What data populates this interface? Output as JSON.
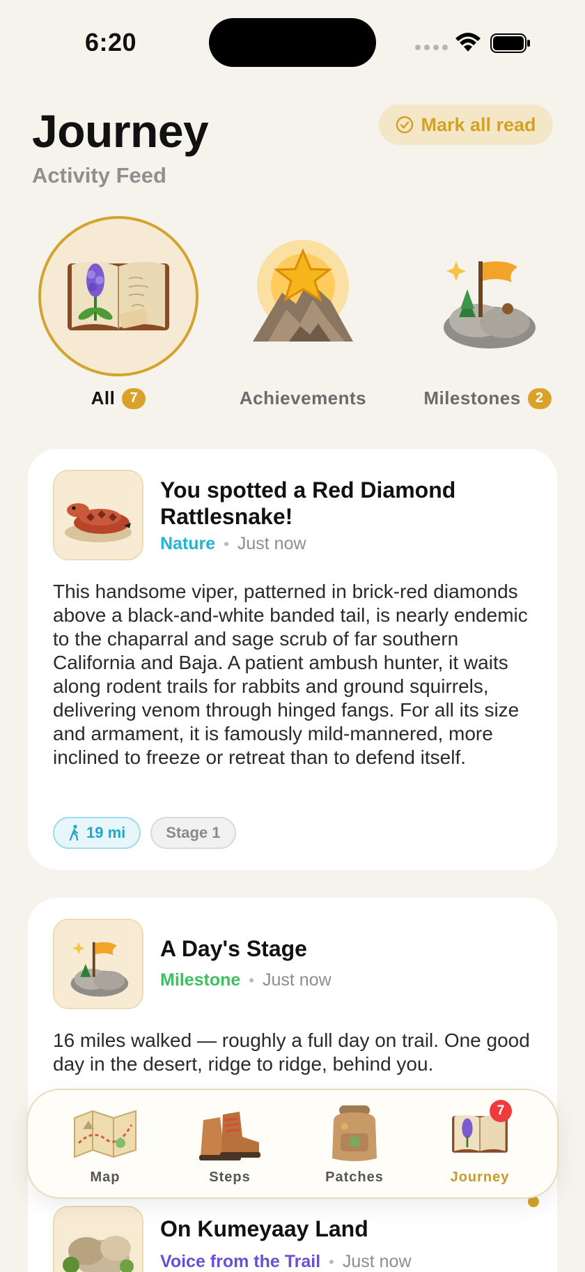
{
  "status_bar": {
    "time": "6:20"
  },
  "header": {
    "title": "Journey",
    "subtitle": "Activity Feed",
    "mark_all_read": "Mark all read"
  },
  "categories": [
    {
      "label": "All",
      "count": "7",
      "active": true,
      "icon": "journal-lupine-icon"
    },
    {
      "label": "Achievements",
      "count": "",
      "active": false,
      "icon": "star-mountain-icon"
    },
    {
      "label": "Milestones",
      "count": "2",
      "active": false,
      "icon": "flag-rock-icon"
    }
  ],
  "feed": [
    {
      "title": "You spotted a Red Diamond Rattlesnake!",
      "category": "Nature",
      "category_color": "#22b5d3",
      "time": "Just now",
      "icon": "rattlesnake-icon",
      "body": "This handsome viper, patterned in brick-red diamonds above a black-and-white banded tail, is nearly endemic to the chaparral and sage scrub of far southern California and Baja. A patient ambush hunter, it waits along rodent trails for rabbits and ground squirrels, delivering venom through hinged fangs. For all its size and armament, it is famously mild-mannered, more inclined to freeze or retreat than to defend itself.",
      "chips": {
        "distance": "19 mi",
        "stage": "Stage 1"
      }
    },
    {
      "title": "A Day's Stage",
      "category": "Milestone",
      "category_color": "#3fbf62",
      "time": "Just now",
      "icon": "flag-rock-icon",
      "body": "16 miles walked — roughly a full day on trail. One good day in the desert, ridge to ridge, behind you."
    },
    {
      "title": "On Kumeyaay Land",
      "category": "Voice from the Trail",
      "category_color": "#6a4fd6",
      "time": "Just now",
      "icon": "boulders-icon"
    }
  ],
  "tabbar": {
    "tabs": [
      {
        "label": "Map",
        "icon": "trail-map-icon"
      },
      {
        "label": "Steps",
        "icon": "hiking-boots-icon"
      },
      {
        "label": "Patches",
        "icon": "backpack-icon"
      },
      {
        "label": "Journey",
        "icon": "journal-lupine-icon",
        "badge": "7",
        "active": true
      }
    ]
  },
  "colors": {
    "accent": "#d4a32c",
    "background": "#f6f2ec",
    "badge": "#ef3b3b"
  }
}
